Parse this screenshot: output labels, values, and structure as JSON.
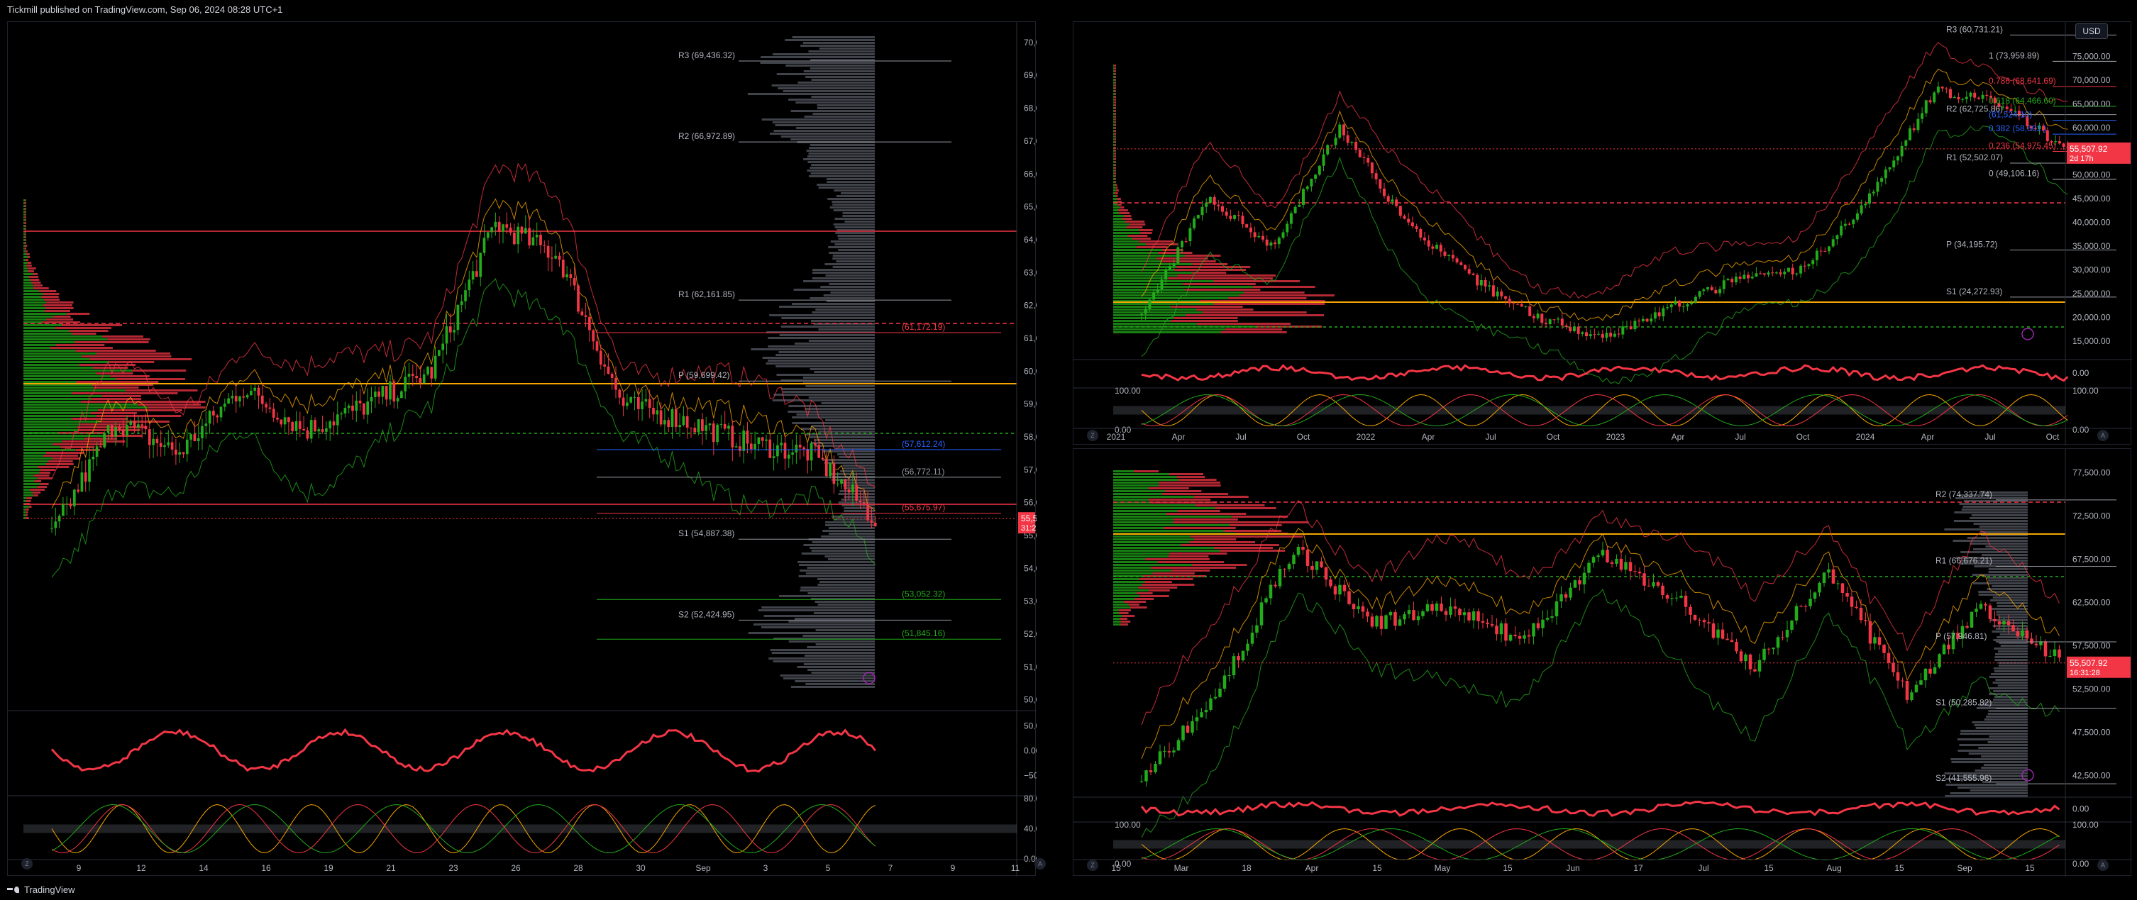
{
  "header": {
    "publisher_text": "Tickmill published on TradingView.com, Sep 06, 2024 08:28 UTC+1"
  },
  "footer": {
    "brand": "TradingView"
  },
  "currency_button": "USD",
  "scale_buttons": [
    "Z",
    "A"
  ],
  "colors": {
    "up": "#22ab1a",
    "down": "#f23645",
    "orange": "#f7a600",
    "bg": "#000000",
    "profile_gray": "#5d606b",
    "blue": "#2962ff"
  },
  "chart_data": [
    {
      "id": "left-chart",
      "type": "candlestick",
      "x_ticks": [
        "9",
        "12",
        "14",
        "16",
        "19",
        "21",
        "23",
        "26",
        "28",
        "30",
        "Sep",
        "3",
        "5",
        "7",
        "9",
        "11"
      ],
      "y_ticks": [
        "70,000.00",
        "69,000.00",
        "68,000.00",
        "67,000.00",
        "66,000.00",
        "65,000.00",
        "64,000.00",
        "63,000.00",
        "62,000.00",
        "61,000.00",
        "60,000.00",
        "59,000.00",
        "58,000.00",
        "57,000.00",
        "56,000.00",
        "55,000.00",
        "54,000.00",
        "53,000.00",
        "52,000.00",
        "51,000.00",
        "50,000.00"
      ],
      "y_range": [
        49800,
        70300
      ],
      "last_price": "55,514.99",
      "countdown": "31:28",
      "pivot_levels": [
        {
          "label": "R3 (69,436.32)",
          "value": 69436.32
        },
        {
          "label": "R2 (66,972.89)",
          "value": 66972.89
        },
        {
          "label": "R1 (62,161.85)",
          "value": 62161.85
        },
        {
          "label": "P (59,699.42)",
          "value": 59699.42
        },
        {
          "label": "S1 (54,887.38)",
          "value": 54887.38
        },
        {
          "label": "S2 (52,424.95)",
          "value": 52424.95
        }
      ],
      "fib_levels": [
        {
          "label": "(61,172.19)",
          "value": 61172.19
        },
        {
          "label": "(57,612.24)",
          "value": 57612.24
        },
        {
          "label": "(56,772.11)",
          "value": 56772.11
        },
        {
          "label": "(55,675.97)",
          "value": 55675.97
        },
        {
          "label": "(53,052.32)",
          "value": 53052.32
        },
        {
          "label": "(51,845.16)",
          "value": 51845.16
        }
      ],
      "osc1_ticks": [
        "50.00",
        "0.00",
        "−50.00"
      ],
      "osc2_ticks": [
        "80.00",
        "40.00",
        "0.00"
      ],
      "osc2_right_ticks": [
        "80.00",
        "40.00"
      ]
    },
    {
      "id": "top-right-chart",
      "type": "candlestick",
      "x_ticks": [
        "2021",
        "Apr",
        "Jul",
        "Oct",
        "2022",
        "Apr",
        "Jul",
        "Oct",
        "2023",
        "Apr",
        "Jul",
        "Oct",
        "2024",
        "Apr",
        "Jul",
        "Oct"
      ],
      "y_ticks": [
        "75,000.00",
        "70,000.00",
        "65,000.00",
        "60,000.00",
        "55,000.00",
        "50,000.00",
        "45,000.00",
        "40,000.00",
        "35,000.00",
        "30,000.00",
        "25,000.00",
        "20,000.00",
        "15,000.00"
      ],
      "y_range": [
        12000,
        80000
      ],
      "last_price": "55,507.92",
      "countdown": "2d 17h",
      "pivot_levels": [
        {
          "label": "R3 (60,731.21)",
          "value": 79500
        },
        {
          "label": "R2 (62,725.86)",
          "value": 62725.86
        },
        {
          "label": "R1 (52,502.07)",
          "value": 52502.07
        },
        {
          "label": "P (34,195.72)",
          "value": 34195.72
        },
        {
          "label": "S1 (24,272.93)",
          "value": 24272.93
        }
      ],
      "fib_levels": [
        {
          "label": "1 (73,959.89)",
          "value": 73959.89
        },
        {
          "label": "0.786 (68,641.69)",
          "value": 68641.69
        },
        {
          "label": "0.618 (64,466.60)",
          "value": 64466.6
        },
        {
          "label": "(61,524.10)",
          "value": 61524.1
        },
        {
          "label": "0.382 (58,601.)",
          "value": 58601
        },
        {
          "label": "0.236 (54,975.45)",
          "value": 54975.45
        },
        {
          "label": "0 (49,106.16)",
          "value": 49106.16
        }
      ],
      "osc1_ticks": [
        "0.00"
      ],
      "osc2_ticks": [
        "100.00",
        "0.00"
      ],
      "osc2_left_ticks": [
        "100.00",
        "0.00"
      ]
    },
    {
      "id": "bottom-right-chart",
      "type": "candlestick",
      "x_ticks": [
        "15",
        "Mar",
        "18",
        "Apr",
        "15",
        "May",
        "15",
        "Jun",
        "17",
        "Jul",
        "15",
        "Aug",
        "15",
        "Sep",
        "15"
      ],
      "y_ticks": [
        "77,500.00",
        "72,500.00",
        "67,500.00",
        "62,500.00",
        "57,500.00",
        "52,500.00",
        "47,500.00",
        "42,500.00"
      ],
      "y_range": [
        40500,
        79000
      ],
      "last_price": "55,507.92",
      "countdown": "16:31:28",
      "pivot_levels": [
        {
          "label": "R2 (74,337.74)",
          "value": 74337.74
        },
        {
          "label": "R1 (66,676.21)",
          "value": 66676.21
        },
        {
          "label": "P (57,946.81)",
          "value": 57946.81
        },
        {
          "label": "S1 (50,285.82)",
          "value": 50285.82
        },
        {
          "label": "S2 (41,555.96)",
          "value": 41555.96
        }
      ],
      "osc1_ticks": [
        "0.00"
      ],
      "osc2_ticks": [
        "100.00",
        "0.00"
      ],
      "osc2_left_ticks": [
        "100.00",
        "0.00"
      ]
    }
  ]
}
